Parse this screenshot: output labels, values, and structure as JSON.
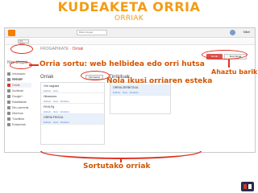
{
  "banner": {
    "title": "KUDEAKETA ORRIA",
    "subtitle": "ORRIAK"
  },
  "blogger": {
    "search_placeholder": "Bilatu blogak",
    "user_name": "Mikel",
    "nav_dropdown": "Orri berria",
    "blogs_title": "Nire blogak",
    "breadcrumb_blog": "FROGAPIKATE",
    "breadcrumb_sep": "·",
    "breadcrumb_section": "Orriak",
    "btn_save": "Gorde antolamendua",
    "btn_view": "Ikusi bloga",
    "sidebar": [
      {
        "label": "Informazio orokorra",
        "active": false
      },
      {
        "label": "Mezuak",
        "active": false
      },
      {
        "label": "Orriak",
        "active": true
      },
      {
        "label": "Iruzkinak",
        "active": false
      },
      {
        "label": "Google+",
        "active": false
      },
      {
        "label": "Estatistikak",
        "active": false
      },
      {
        "label": "Diru-sarrerak",
        "active": false
      },
      {
        "label": "Diseinua",
        "active": false
      },
      {
        "label": "Txantiloia",
        "active": false
      },
      {
        "label": "Ezarpenak",
        "active": false
      }
    ],
    "pages_title": "Orriak",
    "new_page_btn": "Orri berria",
    "pages": [
      {
        "title": "Orri nagusia",
        "links": "Editatu · Ikusi"
      },
      {
        "title": "Hitzaurrea",
        "links": "Editatu · Ikusi · Ezabatu"
      },
      {
        "title": "FKHLPg",
        "links": "Editatu · Ikusi · Ezabatu"
      },
      {
        "title": "ORRIA FROGA",
        "links": "Editatu · Ikusi · Ezabatu"
      }
    ],
    "tabs_title": "Zirrikituak",
    "tabs_pages": [
      {
        "title": "ORRIA ZERBITZUA",
        "links": "Editatu · Ikusi · Ezabatu"
      }
    ]
  },
  "annotations": {
    "sort_pages": "Orria sortu: web helbidea edo orri hutsa",
    "show_pages": "Nola ikusi orriaren esteka",
    "save_order": "Ahaztu barik",
    "created_pages": "Sortutako orriak"
  },
  "colors": {
    "accent_orange": "#f39c12",
    "annot_orange": "#d35400",
    "marker_red": "#e0301e",
    "blogger_orange": "#f57d00"
  }
}
